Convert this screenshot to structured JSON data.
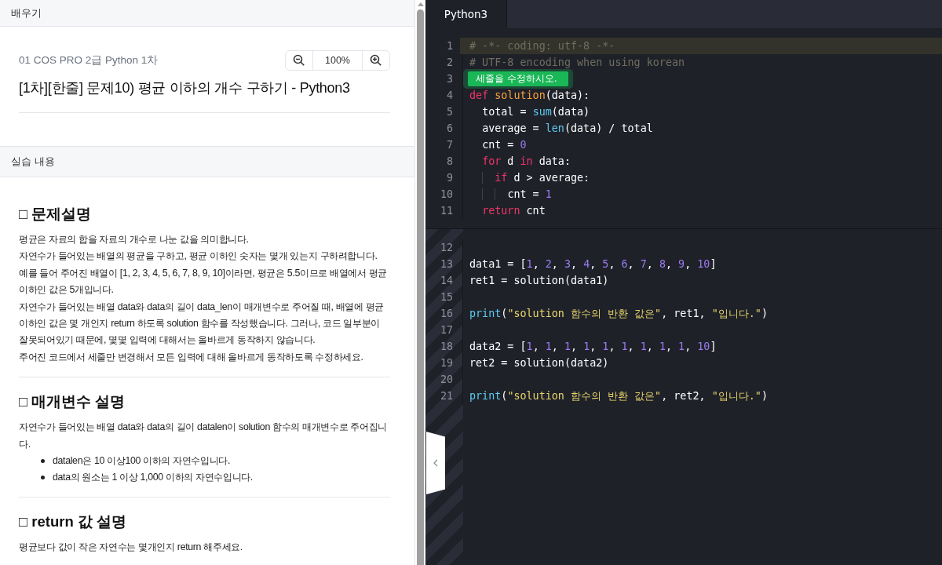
{
  "learn_panel": {
    "header": "배우기",
    "breadcrumb": "01 COS PRO 2급 Python 1차",
    "zoom": {
      "value": "100%"
    },
    "title": "[1차][한줄] 문제10) 평균 이하의 개수 구하기 - Python3",
    "section_header": "실습 내용",
    "sections": [
      {
        "heading": "□ 문제설명",
        "paragraphs": [
          "평균은 자료의 합을 자료의 개수로 나눈 값을 의미합니다.",
          "자연수가 들어있는 배열의 평균을 구하고, 평균 이하인 숫자는 몇개 있는지 구하려합니다.",
          "예를 들어 주어진 배열이 [1, 2, 3, 4, 5, 6, 7, 8, 9, 10]이라면, 평균은 5.5이므로 배열에서 평균 이하인 값은 5개입니다.",
          "자연수가 들어있는 배열 data와 data의 길이 data_len이 매개변수로 주어질 때, 배열에 평균 이하인 값은 몇 개인지 return 하도록 solution 함수를 작성했습니다. 그러나, 코드 일부분이 잘못되어있기 때문에, 몇몇 입력에 대해서는 올바르게 동작하지 않습니다.",
          "주어진 코드에서 세줄만 변경해서 모든 입력에 대해 올바르게 동작하도록 수정하세요."
        ]
      },
      {
        "heading": "□ 매개변수 설명",
        "paragraphs": [
          "자연수가 들어있는 배열 data와 data의 길이 datalen이 solution 함수의 매개변수로 주어집니다."
        ],
        "bullets": [
          "datalen은 10 이상100 이하의 자연수입니다.",
          "data의 원소는 1 이상 1,000 이하의 자연수입니다."
        ]
      },
      {
        "heading": "□ return 값 설명",
        "paragraphs": [
          "평균보다 값이 작은 자연수는 몇개인지 return 해주세요."
        ]
      }
    ]
  },
  "editor": {
    "tabs": [
      {
        "label": "Python3",
        "selected": true
      }
    ],
    "editable_lines": [
      {
        "number": "1",
        "kind": "code",
        "active": true,
        "tokens": [
          {
            "kind": "comment",
            "text": "# -*- coding: utf-8 -*-"
          }
        ]
      },
      {
        "number": "2",
        "kind": "code",
        "active": false,
        "tokens": [
          {
            "kind": "comment",
            "text": "# UTF-8 encoding when using korean"
          }
        ]
      },
      {
        "number": "3",
        "kind": "hint",
        "active": false,
        "text": "세줄을 수정하시오."
      },
      {
        "number": "4",
        "kind": "code",
        "active": false,
        "tokens": [
          {
            "kind": "keyword",
            "text": "def"
          },
          {
            "kind": "function",
            "text": " solution"
          },
          {
            "kind": "plain",
            "text": "(data):"
          }
        ]
      },
      {
        "number": "5",
        "kind": "code",
        "active": false,
        "tokens": [
          {
            "kind": "plain",
            "text": "  total = "
          },
          {
            "kind": "builtin",
            "text": "sum"
          },
          {
            "kind": "plain",
            "text": "(data)"
          }
        ]
      },
      {
        "number": "6",
        "kind": "code",
        "active": false,
        "tokens": [
          {
            "kind": "plain",
            "text": "  average = "
          },
          {
            "kind": "builtin",
            "text": "len"
          },
          {
            "kind": "plain",
            "text": "(data) / total"
          }
        ]
      },
      {
        "number": "7",
        "kind": "code",
        "active": false,
        "tokens": [
          {
            "kind": "plain",
            "text": "  cnt = "
          },
          {
            "kind": "number",
            "text": "0"
          }
        ]
      },
      {
        "number": "8",
        "kind": "code",
        "active": false,
        "tokens": [
          {
            "kind": "keyword",
            "text": "  for"
          },
          {
            "kind": "plain",
            "text": " d "
          },
          {
            "kind": "keyword",
            "text": "in"
          },
          {
            "kind": "plain",
            "text": " data:"
          }
        ]
      },
      {
        "number": "9",
        "kind": "code",
        "active": false,
        "tokens": [
          {
            "kind": "keyword",
            "text": "    if"
          },
          {
            "kind": "plain",
            "text": " d > average:"
          }
        ]
      },
      {
        "number": "10",
        "kind": "code",
        "active": false,
        "tokens": [
          {
            "kind": "plain",
            "text": "      cnt = "
          },
          {
            "kind": "number",
            "text": "1"
          }
        ]
      },
      {
        "number": "11",
        "kind": "code",
        "active": false,
        "tokens": [
          {
            "kind": "keyword",
            "text": "  return"
          },
          {
            "kind": "plain",
            "text": " cnt"
          }
        ]
      }
    ],
    "readonly_lines": [
      {
        "number": "12",
        "kind": "code",
        "active": false
      },
      {
        "number": "13",
        "kind": "code",
        "active": false,
        "tokens": [
          {
            "kind": "plain",
            "text": "data1 = ["
          },
          {
            "kind": "number",
            "text": "1"
          },
          {
            "kind": "plain",
            "text": ", "
          },
          {
            "kind": "number",
            "text": "2"
          },
          {
            "kind": "plain",
            "text": ", "
          },
          {
            "kind": "number",
            "text": "3"
          },
          {
            "kind": "plain",
            "text": ", "
          },
          {
            "kind": "number",
            "text": "4"
          },
          {
            "kind": "plain",
            "text": ", "
          },
          {
            "kind": "number",
            "text": "5"
          },
          {
            "kind": "plain",
            "text": ", "
          },
          {
            "kind": "number",
            "text": "6"
          },
          {
            "kind": "plain",
            "text": ", "
          },
          {
            "kind": "number",
            "text": "7"
          },
          {
            "kind": "plain",
            "text": ", "
          },
          {
            "kind": "number",
            "text": "8"
          },
          {
            "kind": "plain",
            "text": ", "
          },
          {
            "kind": "number",
            "text": "9"
          },
          {
            "kind": "plain",
            "text": ", "
          },
          {
            "kind": "number",
            "text": "10"
          },
          {
            "kind": "plain",
            "text": "]"
          }
        ]
      },
      {
        "number": "14",
        "kind": "code",
        "active": false,
        "tokens": [
          {
            "kind": "plain",
            "text": "ret1 = solution(data1)"
          }
        ]
      },
      {
        "number": "15",
        "kind": "code",
        "active": false
      },
      {
        "number": "16",
        "kind": "code",
        "active": false,
        "tokens": [
          {
            "kind": "builtin",
            "text": "print"
          },
          {
            "kind": "plain",
            "text": "("
          },
          {
            "kind": "string",
            "text": "\"solution 함수의 반환 값은\""
          },
          {
            "kind": "plain",
            "text": ", ret1, "
          },
          {
            "kind": "string",
            "text": "\"입니다.\""
          },
          {
            "kind": "plain",
            "text": ")"
          }
        ]
      },
      {
        "number": "17",
        "kind": "code",
        "active": false
      },
      {
        "number": "18",
        "kind": "code",
        "active": false,
        "tokens": [
          {
            "kind": "plain",
            "text": "data2 = ["
          },
          {
            "kind": "number",
            "text": "1"
          },
          {
            "kind": "plain",
            "text": ", "
          },
          {
            "kind": "number",
            "text": "1"
          },
          {
            "kind": "plain",
            "text": ", "
          },
          {
            "kind": "number",
            "text": "1"
          },
          {
            "kind": "plain",
            "text": ", "
          },
          {
            "kind": "number",
            "text": "1"
          },
          {
            "kind": "plain",
            "text": ", "
          },
          {
            "kind": "number",
            "text": "1"
          },
          {
            "kind": "plain",
            "text": ", "
          },
          {
            "kind": "number",
            "text": "1"
          },
          {
            "kind": "plain",
            "text": ", "
          },
          {
            "kind": "number",
            "text": "1"
          },
          {
            "kind": "plain",
            "text": ", "
          },
          {
            "kind": "number",
            "text": "1"
          },
          {
            "kind": "plain",
            "text": ", "
          },
          {
            "kind": "number",
            "text": "1"
          },
          {
            "kind": "plain",
            "text": ", "
          },
          {
            "kind": "number",
            "text": "10"
          },
          {
            "kind": "plain",
            "text": "]"
          }
        ]
      },
      {
        "number": "19",
        "kind": "code",
        "active": false,
        "tokens": [
          {
            "kind": "plain",
            "text": "ret2 = solution(data2)"
          }
        ]
      },
      {
        "number": "20",
        "kind": "code",
        "active": false
      },
      {
        "number": "21",
        "kind": "code",
        "active": false,
        "tokens": [
          {
            "kind": "builtin",
            "text": "print"
          },
          {
            "kind": "plain",
            "text": "("
          },
          {
            "kind": "string",
            "text": "\"solution 함수의 반환 값은\""
          },
          {
            "kind": "plain",
            "text": ", ret2, "
          },
          {
            "kind": "string",
            "text": "\"입니다.\""
          },
          {
            "kind": "plain",
            "text": ")"
          }
        ]
      }
    ]
  }
}
